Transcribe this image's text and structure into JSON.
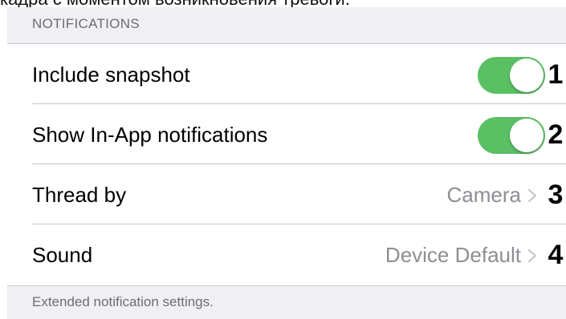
{
  "top_caption": "кадра с моментом возникновения тревоги.",
  "section_header": "NOTIFICATIONS",
  "rows": [
    {
      "label": "Include snapshot",
      "toggle_on": true,
      "marker": "1"
    },
    {
      "label": "Show In-App notifications",
      "toggle_on": true,
      "marker": "2"
    },
    {
      "label": "Thread by",
      "value": "Camera",
      "marker": "3"
    },
    {
      "label": "Sound",
      "value": "Device Default",
      "marker": "4"
    }
  ],
  "footer": "Extended notification settings.",
  "colors": {
    "toggle_on": "#5bbf64",
    "group_background": "#efeff4",
    "secondary_text": "#8e8e93",
    "header_text": "#6d6d72",
    "separator": "#c8c7cc"
  },
  "icons": {
    "chevron": "chevron-right-icon"
  }
}
